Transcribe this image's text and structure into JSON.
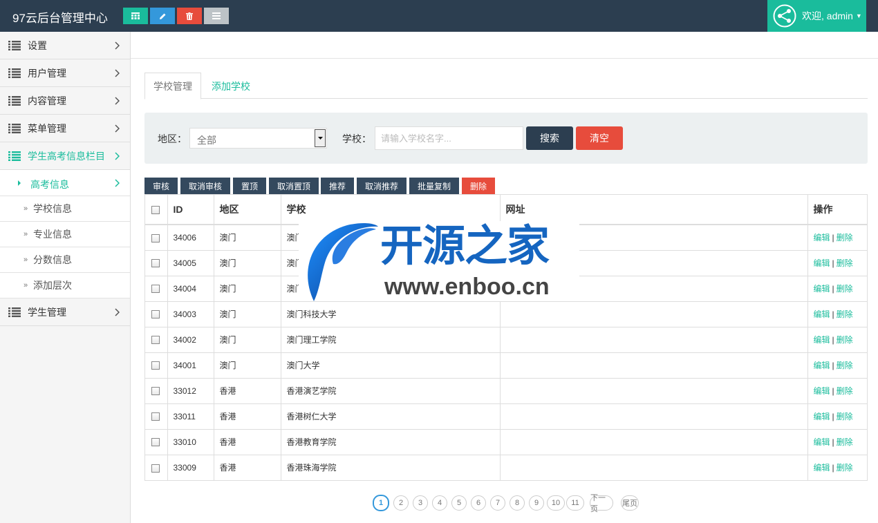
{
  "app": {
    "title": "97云后台管理中心"
  },
  "header": {
    "buttons": [
      {
        "icon": "table-icon",
        "color": "#1abc9c"
      },
      {
        "icon": "pencil-icon",
        "color": "#3498db"
      },
      {
        "icon": "trash-icon",
        "color": "#e74c3c"
      },
      {
        "icon": "list-icon",
        "color": "#bdc3c7"
      }
    ],
    "welcome": "欢迎, admin"
  },
  "sidebar": {
    "items": [
      {
        "label": "设置"
      },
      {
        "label": "用户管理"
      },
      {
        "label": "内容管理"
      },
      {
        "label": "菜单管理"
      },
      {
        "label": "学生高考信息栏目"
      }
    ],
    "active_sub": "高考信息",
    "subitems": [
      {
        "label": "学校信息"
      },
      {
        "label": "专业信息"
      },
      {
        "label": "分数信息"
      },
      {
        "label": "添加层次"
      }
    ],
    "last_item": {
      "label": "学生管理"
    }
  },
  "tabs": [
    {
      "label": "学校管理"
    },
    {
      "label": "添加学校"
    }
  ],
  "filter": {
    "region_label": "地区：",
    "region_value": "全部",
    "school_label": "学校：",
    "school_placeholder": "请输入学校名字...",
    "search_label": "搜索",
    "clear_label": "清空"
  },
  "actions": [
    {
      "label": "审核"
    },
    {
      "label": "取消审核"
    },
    {
      "label": "置顶"
    },
    {
      "label": "取消置顶"
    },
    {
      "label": "推荐"
    },
    {
      "label": "取消推荐"
    },
    {
      "label": "批量复制"
    },
    {
      "label": "删除"
    }
  ],
  "table": {
    "headers": {
      "id": "ID",
      "region": "地区",
      "school": "学校",
      "url": "网址",
      "ops": "操作"
    },
    "edit_label": "编辑",
    "sep": "|",
    "delete_label": "删除",
    "rows": [
      {
        "id": "34006",
        "region": "澳门",
        "school": "澳门",
        "url": ""
      },
      {
        "id": "34005",
        "region": "澳门",
        "school": "澳门",
        "url": ""
      },
      {
        "id": "34004",
        "region": "澳门",
        "school": "澳门",
        "url": ""
      },
      {
        "id": "34003",
        "region": "澳门",
        "school": "澳门科技大学",
        "url": ""
      },
      {
        "id": "34002",
        "region": "澳门",
        "school": "澳门理工学院",
        "url": ""
      },
      {
        "id": "34001",
        "region": "澳门",
        "school": "澳门大学",
        "url": ""
      },
      {
        "id": "33012",
        "region": "香港",
        "school": "香港演艺学院",
        "url": ""
      },
      {
        "id": "33011",
        "region": "香港",
        "school": "香港树仁大学",
        "url": ""
      },
      {
        "id": "33010",
        "region": "香港",
        "school": "香港教育学院",
        "url": ""
      },
      {
        "id": "33009",
        "region": "香港",
        "school": "香港珠海学院",
        "url": ""
      }
    ]
  },
  "watermark": {
    "brand": "开源之家",
    "site": "www.enboo.cn"
  },
  "pagination": {
    "pages": [
      "1",
      "2",
      "3",
      "4",
      "5",
      "6",
      "7",
      "8",
      "9",
      "10",
      "11"
    ],
    "current": "1",
    "next_label": "下一页",
    "last_label": "尾页"
  }
}
